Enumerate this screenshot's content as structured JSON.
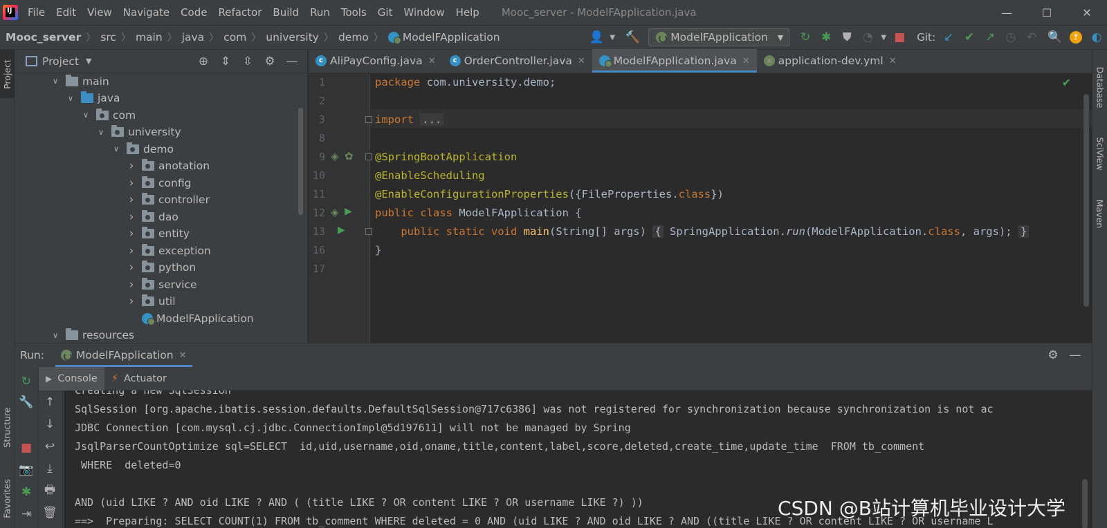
{
  "menu": {
    "items": [
      "File",
      "Edit",
      "View",
      "Navigate",
      "Code",
      "Refactor",
      "Build",
      "Run",
      "Tools",
      "Git",
      "Window",
      "Help"
    ],
    "window_title": "Mooc_server - ModelFApplication.java",
    "minimize": "—",
    "maximize": "☐",
    "close": "✕"
  },
  "breadcrumb": {
    "project": "Mooc_server",
    "parts": [
      "src",
      "main",
      "java",
      "com",
      "university",
      "demo"
    ],
    "file": "ModelFApplication"
  },
  "toolbar": {
    "run_config": "ModelFApplication",
    "git_label": "Git:"
  },
  "left_stripe": {
    "project": "Project",
    "structure": "Structure",
    "favorites": "Favorites"
  },
  "right_stripe": {
    "database": "Database",
    "sciview": "SciView",
    "maven": "Maven"
  },
  "project_panel": {
    "title": "Project",
    "tree": [
      {
        "label": "main",
        "depth": 0,
        "chevron": "down",
        "folder": "plain"
      },
      {
        "label": "java",
        "depth": 1,
        "chevron": "down",
        "folder": "blue"
      },
      {
        "label": "com",
        "depth": 2,
        "chevron": "down",
        "folder": "pkg"
      },
      {
        "label": "university",
        "depth": 3,
        "chevron": "down",
        "folder": "pkg"
      },
      {
        "label": "demo",
        "depth": 4,
        "chevron": "down",
        "folder": "pkg"
      },
      {
        "label": "anotation",
        "depth": 5,
        "chevron": "right",
        "folder": "pkg"
      },
      {
        "label": "config",
        "depth": 5,
        "chevron": "right",
        "folder": "pkg"
      },
      {
        "label": "controller",
        "depth": 5,
        "chevron": "right",
        "folder": "pkg"
      },
      {
        "label": "dao",
        "depth": 5,
        "chevron": "right",
        "folder": "pkg"
      },
      {
        "label": "entity",
        "depth": 5,
        "chevron": "right",
        "folder": "pkg"
      },
      {
        "label": "exception",
        "depth": 5,
        "chevron": "right",
        "folder": "pkg"
      },
      {
        "label": "python",
        "depth": 5,
        "chevron": "right",
        "folder": "pkg"
      },
      {
        "label": "service",
        "depth": 5,
        "chevron": "right",
        "folder": "pkg"
      },
      {
        "label": "util",
        "depth": 5,
        "chevron": "right",
        "folder": "pkg"
      },
      {
        "label": "ModelFApplication",
        "depth": 5,
        "chevron": "none",
        "folder": "springclass"
      },
      {
        "label": "resources",
        "depth": 0,
        "chevron": "down",
        "folder": "plain"
      }
    ]
  },
  "editor": {
    "tabs": [
      {
        "label": "AliPayConfig.java",
        "icon": "class-icon",
        "active": false
      },
      {
        "label": "OrderController.java",
        "icon": "class-icon",
        "active": false
      },
      {
        "label": "ModelFApplication.java",
        "icon": "spring-class-icon",
        "active": true
      },
      {
        "label": "application-dev.yml",
        "icon": "yml-icon",
        "active": false
      }
    ],
    "line_numbers": [
      "1",
      "2",
      "3",
      "8",
      "9",
      "10",
      "11",
      "12",
      "13",
      "16",
      "17"
    ],
    "code": {
      "l1_kw": "package",
      "l1_rest": " com.university.demo;",
      "l3_kw": "import",
      "l3_fold": "...",
      "l9": "@SpringBootApplication",
      "l10": "@EnableScheduling",
      "l11_ann": "@EnableConfigurationProperties",
      "l11_a": "({FileProperties.",
      "l11_kw": "class",
      "l11_b": "})",
      "l12_kw": "public class",
      "l12_rest": " ModelFApplication {",
      "l13_kw": "public static void",
      "l13_fn": "main",
      "l13_args": "(String[] args)",
      "l13_open": "{",
      "l13_call": " SpringApplication.",
      "l13_run": "run",
      "l13_params": "(ModelFApplication.",
      "l13_kw2": "class",
      "l13_end": ", args);",
      "l13_close": "}",
      "l16": "}"
    }
  },
  "run_panel": {
    "label": "Run:",
    "tab": "ModelFApplication",
    "console_tab": "Console",
    "actuator_tab": "Actuator",
    "lines": [
      "Creating a new SqlSession",
      "SqlSession [org.apache.ibatis.session.defaults.DefaultSqlSession@717c6386] was not registered for synchronization because synchronization is not ac",
      "JDBC Connection [com.mysql.cj.jdbc.ConnectionImpl@5d197611] will not be managed by Spring",
      "JsqlParserCountOptimize sql=SELECT  id,uid,username,oid,oname,title,content,label,score,deleted,create_time,update_time  FROM tb_comment",
      " WHERE  deleted=0",
      "",
      "AND (uid LIKE ? AND oid LIKE ? AND ( (title LIKE ? OR content LIKE ? OR username LIKE ?) ))",
      "==>  Preparing: SELECT COUNT(1) FROM tb_comment WHERE deleted = 0 AND (uid LIKE ? AND oid LIKE ? AND ((title LIKE ? OR content LIKE ? OR username L"
    ]
  },
  "watermark": "CSDN @B站计算机毕业设计大学"
}
